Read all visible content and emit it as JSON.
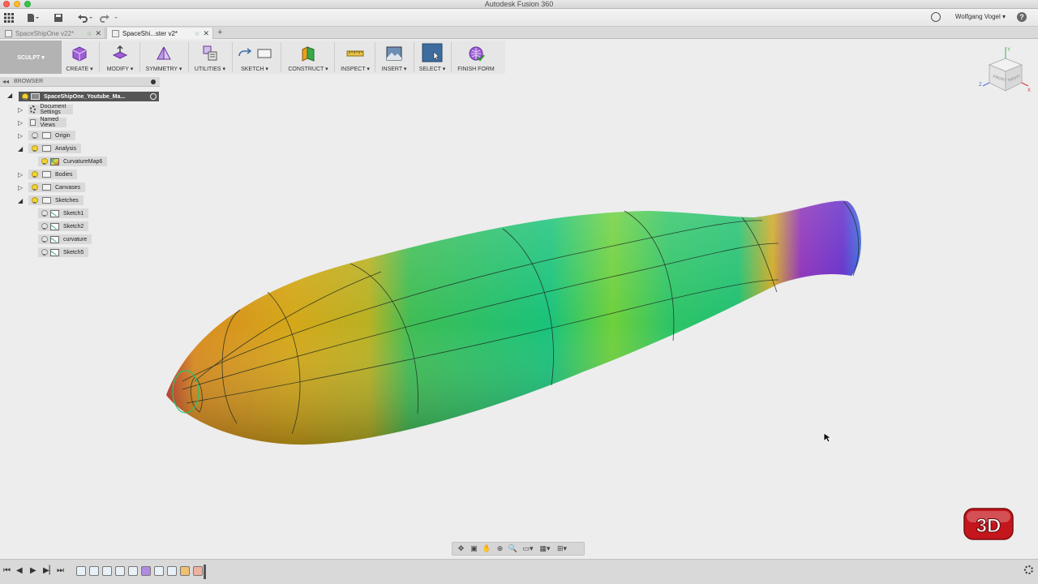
{
  "window": {
    "title": "Autodesk Fusion 360"
  },
  "app_toolbar": {
    "user_name": "Wolfgang Vogel ▾"
  },
  "tabs": [
    {
      "label": "SpaceShipOne v22*"
    },
    {
      "label": "SpaceShi...ster v2*"
    }
  ],
  "ribbon": {
    "workspace": "SCULPT ▾",
    "tools": [
      {
        "label": "CREATE ▾",
        "icon": "create-box-icon"
      },
      {
        "label": "MODIFY ▾",
        "icon": "modify-icon"
      },
      {
        "label": "SYMMETRY ▾",
        "icon": "symmetry-icon"
      },
      {
        "label": "UTILITIES ▾",
        "icon": "utilities-icon"
      },
      {
        "label": "SKETCH ▾",
        "icon": "sketch-icon"
      },
      {
        "label": "CONSTRUCT ▾",
        "icon": "construct-icon"
      },
      {
        "label": "INSPECT ▾",
        "icon": "inspect-icon"
      },
      {
        "label": "INSERT ▾",
        "icon": "insert-icon"
      },
      {
        "label": "SELECT ▾",
        "icon": "select-icon"
      },
      {
        "label": "FINISH FORM",
        "icon": "finish-form-icon"
      }
    ]
  },
  "browser": {
    "title": "BROWSER",
    "root": "SpaceShipOne_Youtube_Ma...",
    "items": [
      {
        "label": "Document Settings"
      },
      {
        "label": "Named Views"
      },
      {
        "label": "Origin"
      },
      {
        "label": "Analysis"
      },
      {
        "label": "CurvatureMap6"
      },
      {
        "label": "Bodies"
      },
      {
        "label": "Canvases"
      },
      {
        "label": "Sketches"
      },
      {
        "label": "Sketch1"
      },
      {
        "label": "Sketch2"
      },
      {
        "label": "curvature"
      },
      {
        "label": "Sketch5"
      }
    ]
  },
  "viewcube": {
    "front": "FRONT",
    "right": "RIGHT",
    "axis_x": "X",
    "axis_y": "Y",
    "axis_z": "Z"
  },
  "logo": {
    "text": "3D"
  },
  "colors": {
    "accent_select": "#3d6d9e",
    "ribbon_bg": "#e6e6e6",
    "canvas_bg": "#ededed"
  }
}
